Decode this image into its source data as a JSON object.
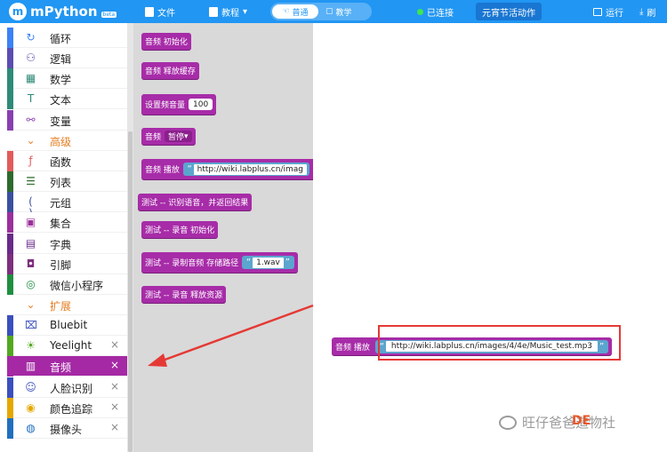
{
  "topbar": {
    "logo": "mPython",
    "logo_badge": "beta",
    "file": "文件",
    "tutorial": "教程",
    "mode_normal": "普通",
    "mode_teach": "教学",
    "connected": "已连接",
    "activity": "元宵节活动作",
    "run": "运行",
    "flash": "刷"
  },
  "sidebar": {
    "categories": [
      {
        "label": "循环",
        "icon": "loop-icon",
        "color": "#3b82f6"
      },
      {
        "label": "逻辑",
        "icon": "logic-icon",
        "color": "#5c4db1"
      },
      {
        "label": "数学",
        "icon": "math-icon",
        "color": "#2e8b78"
      },
      {
        "label": "文本",
        "icon": "text-icon",
        "color": "#2e8b78"
      },
      {
        "label": "变量",
        "icon": "variable-icon",
        "color": "#8a3fb0"
      },
      {
        "label": "高级",
        "icon": "chevron-down-icon"
      },
      {
        "label": "函数",
        "icon": "function-icon",
        "color": "#e25b5b"
      },
      {
        "label": "列表",
        "icon": "list-icon",
        "color": "#2d6b2d"
      },
      {
        "label": "元组",
        "icon": "tuple-icon",
        "color": "#3a4fa0"
      },
      {
        "label": "集合",
        "icon": "set-icon",
        "color": "#9c2f9c"
      },
      {
        "label": "字典",
        "icon": "dict-icon",
        "color": "#6a2a8a"
      },
      {
        "label": "引脚",
        "icon": "pin-icon",
        "color": "#7e2e7e"
      },
      {
        "label": "微信小程序",
        "icon": "wechat-mini-icon",
        "color": "#1f8f3f"
      },
      {
        "label": "扩展",
        "icon": "chevron-down-icon"
      },
      {
        "label": "Bluebit",
        "icon": "bluebit-icon",
        "color": "#3a4fbf"
      },
      {
        "label": "Yeelight",
        "icon": "yeelight-icon",
        "color": "#53a81f"
      },
      {
        "label": "音频",
        "icon": "audio-icon",
        "color": "#a529a5"
      },
      {
        "label": "人脸识别",
        "icon": "face-icon",
        "color": "#3a4fbf"
      },
      {
        "label": "颜色追踪",
        "icon": "color-track-icon",
        "color": "#e6a700"
      },
      {
        "label": "摄像头",
        "icon": "camera-icon",
        "color": "#1f6fbf"
      }
    ]
  },
  "flyout": {
    "b1": "音频 初始化",
    "b2": "音频 释放缓存",
    "b3": "设置频音量",
    "b3_val": "100",
    "b4": "音频",
    "b4_dd": "暂停",
    "b5": "音频 播放",
    "b5_url": "http://wiki.labplus.cn/imag",
    "b6": "测试 -- 识别语音，并返回结果",
    "b7": "测试 -- 录音 初始化",
    "b8": "测试 -- 录制音频 存储路径",
    "b8_file": "1.wav",
    "b9": "测试 -- 录音 释放资源"
  },
  "workspace": {
    "block": "音频 播放",
    "url": "http://wiki.labplus.cn/images/4/4e/Music_test.mp3"
  },
  "watermark": {
    "text": "旺仔爸爸造物社",
    "de": "DE"
  }
}
